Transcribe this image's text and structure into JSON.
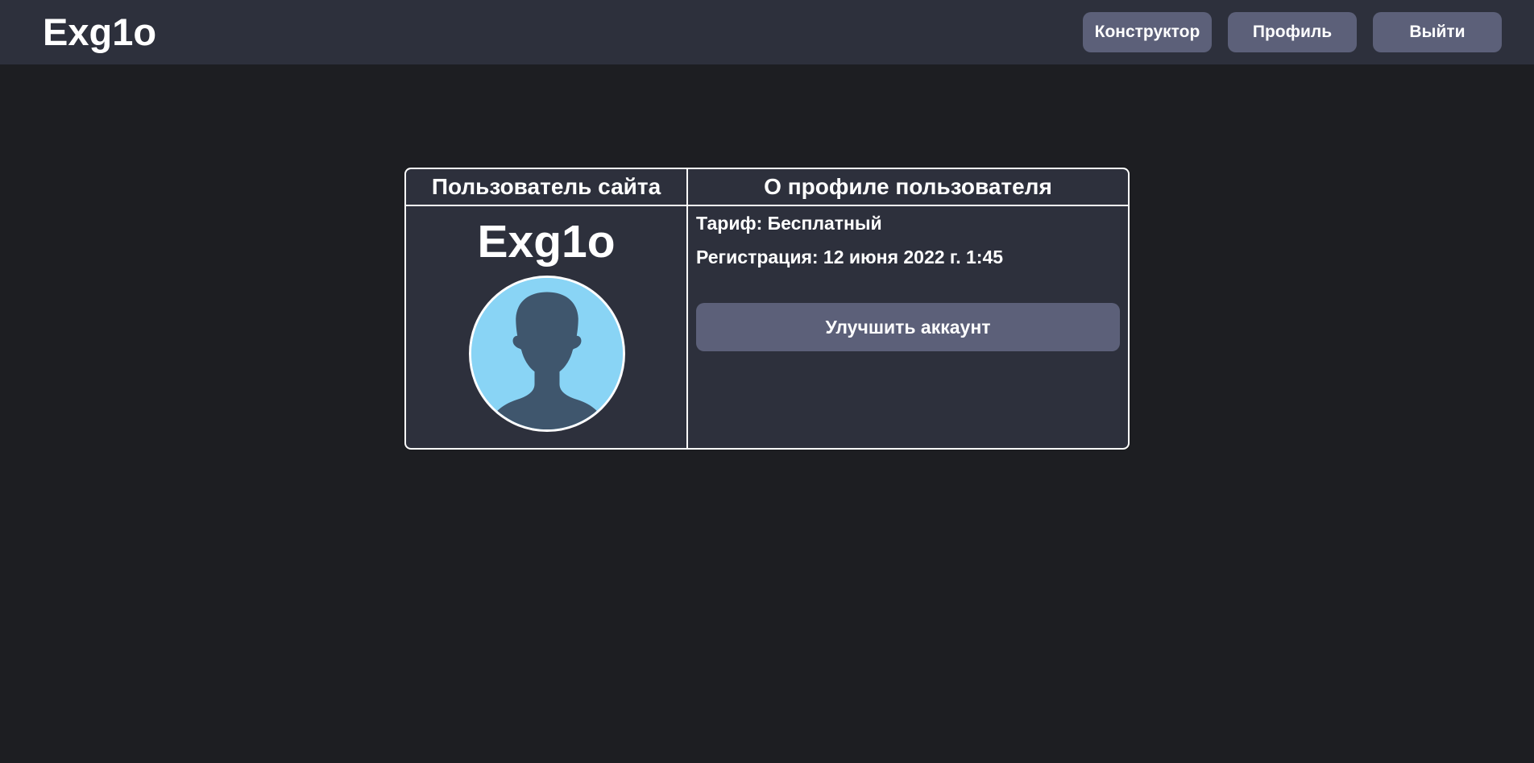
{
  "header": {
    "logo": "Exg1o",
    "nav": {
      "constructor_label": "Конструктор",
      "profile_label": "Профиль",
      "logout_label": "Выйти"
    }
  },
  "profile": {
    "left_heading": "Пользователь сайта",
    "right_heading": "О профиле пользователя",
    "username": "Exg1o",
    "avatar_icon": "user-silhouette-icon",
    "tariff_text": "Тариф: Бесплатный",
    "registration_text": "Регистрация: 12 июня 2022 г. 1:45",
    "upgrade_label": "Улучшить аккаунт"
  },
  "colors": {
    "page_background": "#1d1e22",
    "panel_background": "#2d303c",
    "button_background": "#5c6079",
    "avatar_background": "#89d4f5",
    "avatar_silhouette": "#3f566d",
    "text": "#ffffff"
  }
}
